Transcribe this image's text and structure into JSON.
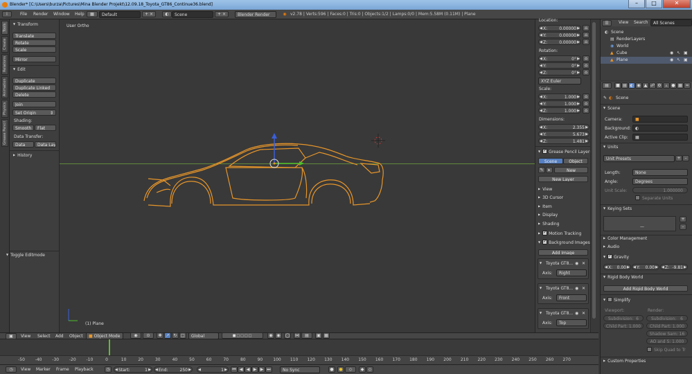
{
  "window": {
    "title": "Blender* [C:\\Users\\burza\\Pictures\\Mina Blender Projekt\\12.09.18_Toyota_GT86_Continue36.blend]"
  },
  "menubar": {
    "file": "File",
    "render": "Render",
    "window": "Window",
    "help": "Help",
    "layout": "Default",
    "scene": "Scene",
    "engine": "Blender Render",
    "stats": "v2.78 | Verts:596 | Faces:0 | Tris:0 | Objects:1/2 | Lamps:0/0 | Mem:5.58M (0.11M) | Plane"
  },
  "lefttabs": [
    "Tools",
    "Create",
    "Relations",
    "Animation",
    "Physics",
    "Grease Pencil"
  ],
  "tools": {
    "transform": "Transform",
    "translate": "Translate",
    "rotate": "Rotate",
    "scale": "Scale",
    "mirror": "Mirror",
    "edit": "Edit",
    "duplicate": "Duplicate",
    "duplicate_linked": "Duplicate Linked",
    "delete": "Delete",
    "join": "Join",
    "set_origin": "Set Origin",
    "shading": "Shading:",
    "smooth": "Smooth",
    "flat": "Flat",
    "data_transfer": "Data Transfer:",
    "data": "Data",
    "data_layout": "Data Layo",
    "history": "History",
    "toggle_editmode": "Toggle Editmode"
  },
  "viewport": {
    "view_label": "User Ortho",
    "object_label": "(1) Plane"
  },
  "npanel": {
    "location": "Location:",
    "rotation": "Rotation:",
    "scale": "Scale:",
    "dimensions": "Dimensions:",
    "loc": [
      {
        "l": "X:",
        "v": "0.00000"
      },
      {
        "l": "Y:",
        "v": "0.00000"
      },
      {
        "l": "Z:",
        "v": "0.00000"
      }
    ],
    "rot": [
      {
        "l": "X:",
        "v": "0°"
      },
      {
        "l": "Y:",
        "v": "0°"
      },
      {
        "l": "Z:",
        "v": "0°"
      }
    ],
    "rot_mode": "XYZ Euler",
    "scl": [
      {
        "l": "X:",
        "v": "1.000"
      },
      {
        "l": "Y:",
        "v": "1.000"
      },
      {
        "l": "Z:",
        "v": "1.000"
      }
    ],
    "dim": [
      {
        "l": "X:",
        "v": "2.355"
      },
      {
        "l": "Y:",
        "v": "5.673"
      },
      {
        "l": "Z:",
        "v": "1.481"
      }
    ],
    "grease_pencil": "Grease Pencil Layers",
    "scene_tab": "Scene",
    "object_tab": "Object",
    "new": "New",
    "new_layer": "New Layer",
    "view": "View",
    "cursor": "3D Cursor",
    "item": "Item",
    "display": "Display",
    "shading": "Shading",
    "motion_tracking": "Motion Tracking",
    "background_images": "Background Images",
    "add_image": "Add Image",
    "bg": [
      {
        "name": "Toyota GT8...",
        "axis_label": "Axis:",
        "axis": "Right"
      },
      {
        "name": "Toyota GT8...",
        "axis_label": "Axis:",
        "axis": "Front"
      },
      {
        "name": "Toyota GT8...",
        "axis_label": "Axis:",
        "axis": "Top"
      }
    ]
  },
  "outliner": {
    "view": "View",
    "search": "Search",
    "all_scenes": "All Scenes",
    "items": [
      "Scene",
      "RenderLayers",
      "World",
      "Cube",
      "Plane"
    ]
  },
  "props": {
    "scene_breadcrumb": "Scene",
    "scene_panel": "Scene",
    "camera": "Camera:",
    "background": "Background:",
    "active_clip": "Active Clip:",
    "units": "Units",
    "unit_presets": "Unit Presets",
    "length": "Length:",
    "length_val": "None",
    "angle": "Angle:",
    "angle_val": "Degrees",
    "unit_scale": "Unit Scale:",
    "unit_scale_val": "1.000000",
    "separate_units": "Separate Units",
    "keying_sets": "Keying Sets",
    "color_management": "Color Management",
    "audio": "Audio",
    "gravity": "Gravity",
    "gx": {
      "l": "X:",
      "v": "0.00"
    },
    "gy": {
      "l": "Y:",
      "v": "0.00"
    },
    "gz": {
      "l": "Z:",
      "v": "-9.81"
    },
    "rigid_body_world": "Rigid Body World",
    "add_rigid": "Add Rigid Body World",
    "simplify": "Simplify",
    "viewport": "Viewport:",
    "render": "Render:",
    "sub_v": "Subdivision:",
    "sub_v_val": "6",
    "sub_r": "Subdivision:",
    "sub_r_val": "6",
    "child_v": "Child Part: 1.000",
    "child_r": "Child Part: 1.000",
    "shadow": "Shadow Sam: 16",
    "ao": "AO and S: 1.000",
    "skip_quad": "Skip Quad to Tr",
    "custom_props": "Custom Properties"
  },
  "vheader": {
    "view": "View",
    "select": "Select",
    "add": "Add",
    "object": "Object",
    "mode": "Object Mode",
    "orientation": "Global"
  },
  "timeline": {
    "ticks": [
      "-50",
      "-40",
      "-30",
      "-20",
      "-10",
      "0",
      "10",
      "20",
      "30",
      "40",
      "50",
      "60",
      "70",
      "80",
      "90",
      "100",
      "110",
      "120",
      "130",
      "140",
      "150",
      "160",
      "170",
      "180",
      "190",
      "200",
      "210",
      "220",
      "230",
      "240",
      "250",
      "260",
      "270"
    ],
    "view": "View",
    "marker": "Marker",
    "frame": "Frame",
    "playback": "Playback",
    "start_label": "Start:",
    "start": "1",
    "end_label": "End:",
    "end": "250",
    "current": "1",
    "sync": "No Sync"
  }
}
